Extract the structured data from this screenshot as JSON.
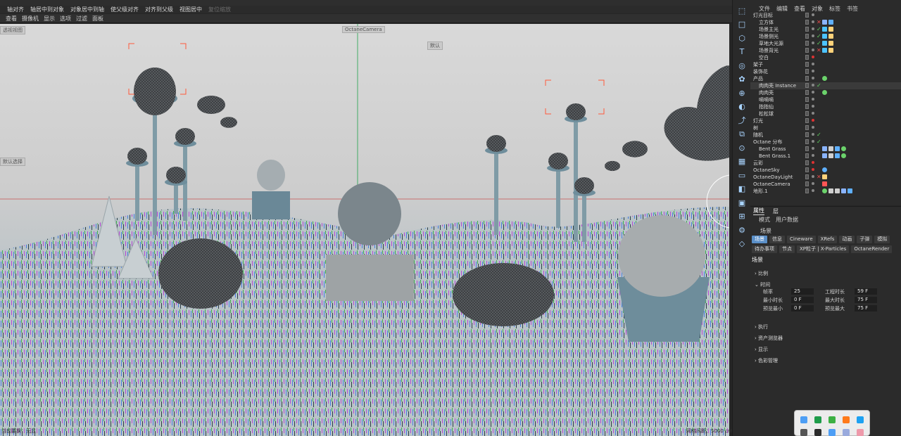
{
  "toolbar_top": {
    "items": [
      "轴对齐",
      "轴居中到对象",
      "对象居中到轴",
      "使父级对齐",
      "对齐到父级",
      "视图居中",
      "复位缩放"
    ]
  },
  "viewport_menu": [
    "查看",
    "摄像机",
    "显示",
    "选项",
    "过滤",
    "面板"
  ],
  "viewport": {
    "camera_label": "OctaneCamera",
    "overlay_tl": "透视视图",
    "overlay_mid": "默认",
    "overlay_left2": "默认选择",
    "status_left": "当前要换：无显",
    "status_right": "网格间距：5000 cm"
  },
  "object_manager": {
    "menu": [
      "文件",
      "编辑",
      "查看",
      "对象",
      "标签",
      "书签"
    ],
    "rows": [
      {
        "name": "灯光目标",
        "indent": 0,
        "dot": "#888",
        "check": "",
        "tags": []
      },
      {
        "name": "立方体",
        "indent": 1,
        "dot": "#888",
        "check": "✕",
        "tags": [
          "uv",
          "cube"
        ]
      },
      {
        "name": "场景主光",
        "indent": 1,
        "dot": "#888",
        "check": "✓",
        "tags": [
          "target",
          "light"
        ]
      },
      {
        "name": "场景侧光",
        "indent": 1,
        "dot": "#888",
        "check": "✓",
        "tags": [
          "target",
          "light"
        ]
      },
      {
        "name": "草地大光源",
        "indent": 1,
        "dot": "#888",
        "check": "✓",
        "tags": [
          "target",
          "light"
        ]
      },
      {
        "name": "场景背光",
        "indent": 1,
        "dot": "#888",
        "check": "✕",
        "tags": [
          "target",
          "light"
        ]
      },
      {
        "name": "空白",
        "indent": 1,
        "dot": "#d33",
        "check": "",
        "tags": []
      },
      {
        "name": "架子",
        "indent": 0,
        "dot": "#888",
        "check": "",
        "tags": []
      },
      {
        "name": "装饰花",
        "indent": 0,
        "dot": "#888",
        "check": "",
        "tags": []
      },
      {
        "name": "产品",
        "indent": 0,
        "dot": "#888",
        "check": "",
        "tags": [
          "sphere"
        ]
      },
      {
        "name": "肉肉壳 Instance",
        "indent": 1,
        "dot": "#888",
        "check": "✓",
        "tags": []
      },
      {
        "name": "肉肉壳",
        "indent": 1,
        "dot": "#888",
        "check": "",
        "tags": [
          "sphere"
        ]
      },
      {
        "name": "嘀嘀嘀",
        "indent": 1,
        "dot": "#888",
        "check": "",
        "tags": []
      },
      {
        "name": "指指仙",
        "indent": 1,
        "dot": "#888",
        "check": "",
        "tags": []
      },
      {
        "name": "松松球",
        "indent": 1,
        "dot": "#888",
        "check": "",
        "tags": []
      },
      {
        "name": "灯光",
        "indent": 0,
        "dot": "#d33",
        "check": "",
        "tags": []
      },
      {
        "name": "树",
        "indent": 0,
        "dot": "#888",
        "check": "",
        "tags": []
      },
      {
        "name": "随机",
        "indent": 0,
        "dot": "#888",
        "check": "✓",
        "tags": []
      },
      {
        "name": "Octane 分布",
        "indent": 0,
        "dot": "#888",
        "check": "✓",
        "tags": []
      },
      {
        "name": "Bent Grass",
        "indent": 1,
        "dot": "#888",
        "check": "",
        "tags": [
          "uv",
          "tri",
          "cube",
          "sphere"
        ]
      },
      {
        "name": "Bent Grass.1",
        "indent": 1,
        "dot": "#888",
        "check": "",
        "tags": [
          "uv",
          "tri",
          "cube",
          "sphere"
        ]
      },
      {
        "name": "云彩",
        "indent": 0,
        "dot": "#d33",
        "check": "",
        "tags": []
      },
      {
        "name": "OctaneSky",
        "indent": 0,
        "dot": "#d33",
        "check": "",
        "tags": [
          "sky"
        ]
      },
      {
        "name": "OctaneDayLight",
        "indent": 0,
        "dot": "#888",
        "check": "✕",
        "tags": [
          "sun"
        ]
      },
      {
        "name": "OctaneCamera",
        "indent": 0,
        "dot": "#888",
        "check": "",
        "tags": [
          "cam"
        ]
      },
      {
        "name": "地形.1",
        "indent": 0,
        "dot": "#888",
        "check": "",
        "tags": [
          "sphere",
          "grid",
          "tri",
          "uv",
          "cube"
        ]
      }
    ]
  },
  "attributes": {
    "tabs": [
      "属性",
      "层"
    ],
    "subtabs": [
      "模式",
      "用户数据"
    ],
    "panel_title": "场景",
    "scene_tabs": [
      "场景",
      "信息",
      "Cineware",
      "XRefs",
      "动画",
      "子弹",
      "模拟",
      "待办事项",
      "节点",
      "XP粒子 | X-Particles",
      "OctaneRender"
    ],
    "section_title": "场景",
    "groups": [
      "比例",
      "时间",
      "执行",
      "资产测览器",
      "显示",
      "色彩管理"
    ],
    "time_fields": [
      {
        "label": "帧率",
        "value": "25",
        "label2": "工程时长",
        "value2": "59 F"
      },
      {
        "label": "最小时长",
        "value": "0 F",
        "label2": "最大时长",
        "value2": "75 F"
      },
      {
        "label": "预览最小",
        "value": "0 F",
        "label2": "预览最大",
        "value2": "75 F"
      }
    ]
  },
  "colors": {
    "accent": "#5a8fc8",
    "selection": "#ff5a3c",
    "ground": "#bcc8cc"
  }
}
